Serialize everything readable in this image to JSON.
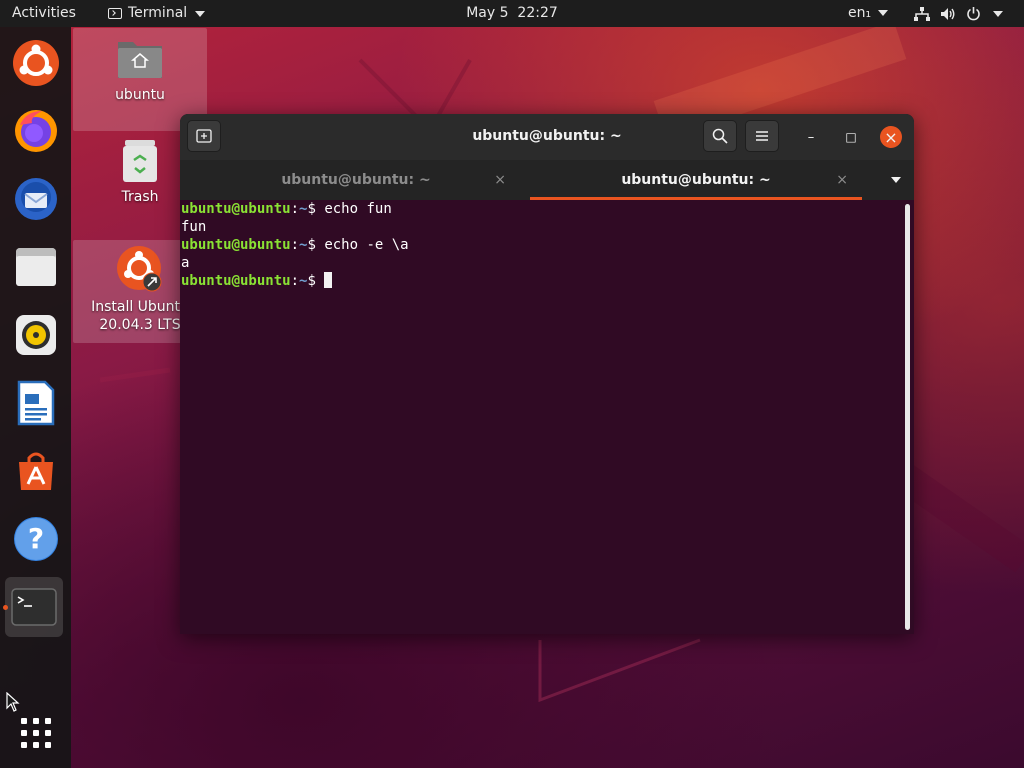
{
  "topbar": {
    "activities": "Activities",
    "app_name": "Terminal",
    "clock": "May 5  22:27",
    "language": "en₁"
  },
  "desktop": {
    "icons": [
      {
        "label": "ubuntu",
        "icon": "home-folder-icon"
      },
      {
        "label": "Trash",
        "icon": "trash-icon"
      },
      {
        "label_line1": "Install Ubuntu",
        "label_line2": "20.04.3 LTS",
        "icon": "ubuntu-installer-icon"
      }
    ]
  },
  "dock": {
    "items": [
      "ubuntu-installer-icon",
      "firefox-icon",
      "thunderbird-icon",
      "files-icon",
      "rhythmbox-icon",
      "libreoffice-writer-icon",
      "ubuntu-software-icon",
      "help-icon",
      "terminal-icon"
    ],
    "show_apps": "show-applications-icon"
  },
  "window": {
    "title": "ubuntu@ubuntu: ~",
    "tabs": [
      {
        "label": "ubuntu@ubuntu: ~",
        "active": false,
        "close": "×"
      },
      {
        "label": "ubuntu@ubuntu: ~",
        "active": true,
        "close": "×"
      }
    ],
    "controls": {
      "minimize": "–",
      "maximize": "□",
      "close": "×"
    }
  },
  "terminal": {
    "prompt_user": "ubuntu@ubuntu",
    "prompt_sep": ":",
    "prompt_path": "~",
    "prompt_symbol": "$ ",
    "cmd1": "echo fun",
    "out1": "fun",
    "cmd2": "echo -e \\a",
    "out2": "a"
  },
  "colors": {
    "accent": "#e95420",
    "terminal_bg": "#300a24",
    "prompt_user": "#8ae234",
    "prompt_path": "#729fcf"
  }
}
